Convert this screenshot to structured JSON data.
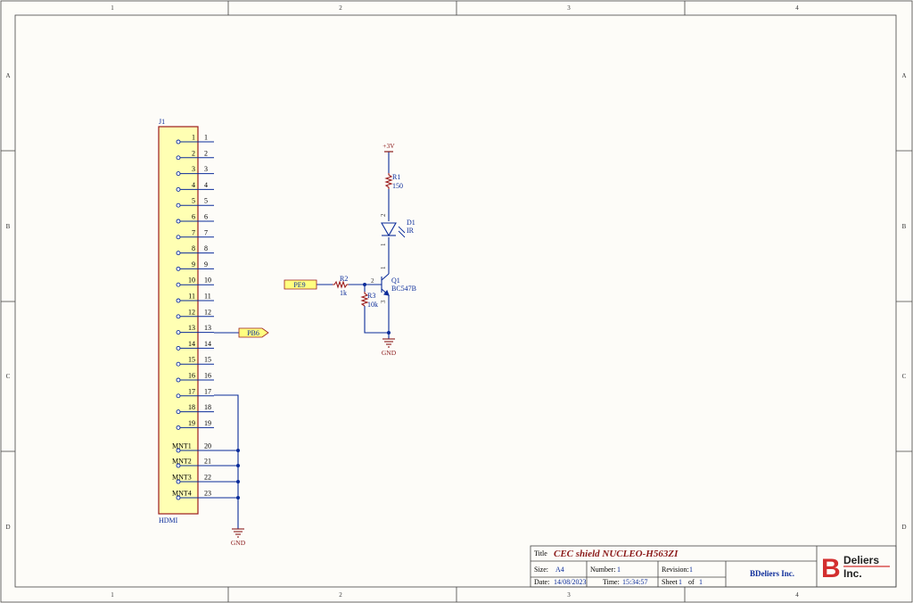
{
  "zones": {
    "columns": [
      "1",
      "2",
      "3",
      "4"
    ],
    "rows": [
      "A",
      "B",
      "C",
      "D"
    ]
  },
  "connector": {
    "designator": "J1",
    "type": "HDMI",
    "inner_pins": [
      "1",
      "2",
      "3",
      "4",
      "5",
      "6",
      "7",
      "8",
      "9",
      "10",
      "11",
      "12",
      "13",
      "14",
      "15",
      "16",
      "17",
      "18",
      "19",
      "MNT1",
      "MNT2",
      "MNT3",
      "MNT4"
    ],
    "outer_pins": [
      "1",
      "2",
      "3",
      "4",
      "5",
      "6",
      "7",
      "8",
      "9",
      "10",
      "11",
      "12",
      "13",
      "14",
      "15",
      "16",
      "17",
      "18",
      "19",
      "20",
      "21",
      "22",
      "23"
    ]
  },
  "ports": {
    "pb6": "PB6",
    "pe9": "PE9"
  },
  "power": {
    "vcc": "+3V",
    "gnd1": "GND",
    "gnd2": "GND"
  },
  "components": {
    "r1": {
      "ref": "R1",
      "value": "150"
    },
    "r2": {
      "ref": "R2",
      "value": "1k"
    },
    "r3": {
      "ref": "R3",
      "value": "10k"
    },
    "d1": {
      "ref": "D1",
      "value": "IR",
      "pin_a": "2",
      "pin_k": "1"
    },
    "q1": {
      "ref": "Q1",
      "value": "BC547B",
      "pin_b": "2",
      "pin_c": "1",
      "pin_e": "3"
    }
  },
  "title_block": {
    "title_label": "Title",
    "title": "CEC shield NUCLEO-H563ZI",
    "size_label": "Size:",
    "size": "A4",
    "number_label": "Number:",
    "number": "1",
    "revision_label": "Revision:",
    "revision": "1",
    "date_label": "Date:",
    "date": "14/08/2023",
    "time_label": "Time:",
    "time": "15:34:57",
    "sheet_label": "Sheet",
    "sheet": "1",
    "of_label": "of",
    "sheets": "1",
    "company": "BDeliers Inc.",
    "logo_letter": "B",
    "logo_line1": "Deliers",
    "logo_line2": "Inc."
  },
  "colors": {
    "wire": "#0b2c9a",
    "component": "#9b1c1c",
    "power": "#8b1a1a",
    "connector_fill": "#ffffb3",
    "port_fill": "#ffff80",
    "logo_red": "#d32f2f"
  }
}
